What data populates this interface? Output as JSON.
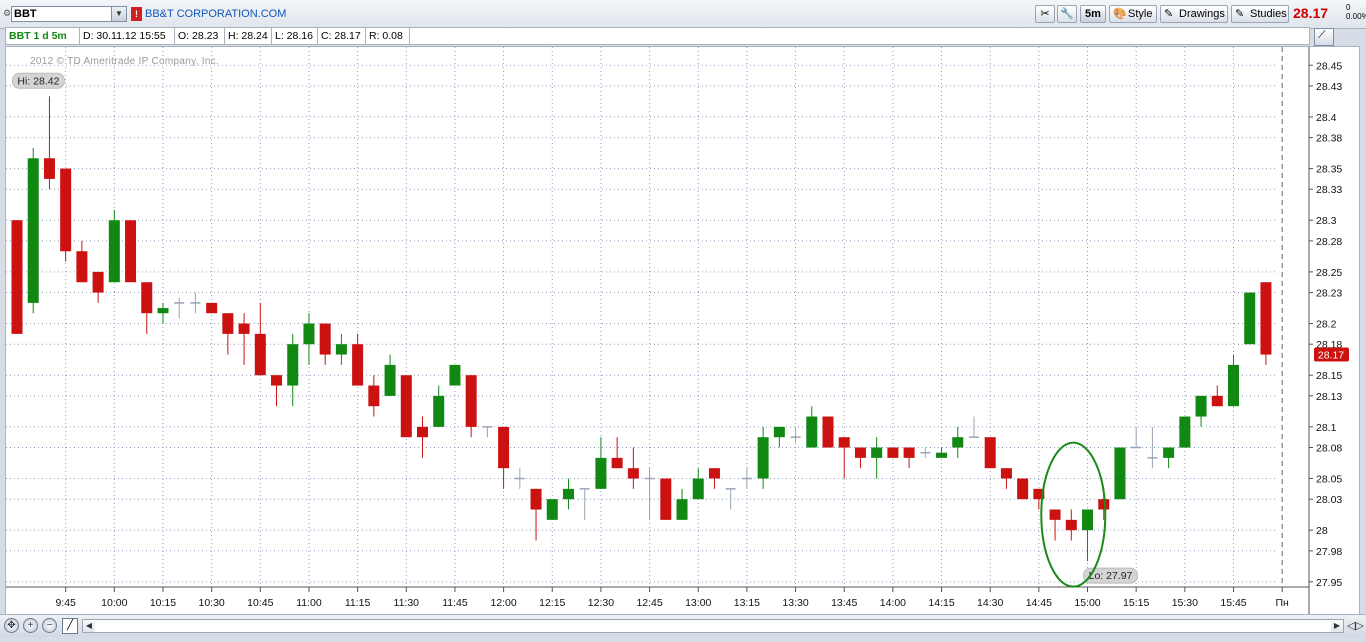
{
  "header": {
    "symbol": "BBT",
    "company_link": "BB&T CORPORATION.COM",
    "toolbar": {
      "interval_label": "5m",
      "style_label": "Style",
      "drawings_label": "Drawings",
      "studies_label": "Studies"
    },
    "last_price": "28.17",
    "change": "0",
    "change_pct": "0.00%"
  },
  "infobar": {
    "symbol_period": "BBT 1 d 5m",
    "date": "D: 30.11.12 15:55",
    "open": "O: 28.23",
    "high": "H: 28.24",
    "low": "L: 28.16",
    "close": "C: 28.17",
    "range": "R: 0.08"
  },
  "copyright": "2012 © TD Ameritrade IP Company, Inc.",
  "hi_label": "Hi: 28.42",
  "lo_label": "Lo: 27.97",
  "price_tag": "28.17",
  "colors": {
    "up": "#118811",
    "down": "#cc1111",
    "doji": "#9aa4b4",
    "ellipse": "#1a8a1a",
    "grid": "#8f9fb8"
  },
  "chart_data": {
    "type": "candlestick",
    "interval": "5m",
    "y_ticks": [
      "28.45",
      "28.43",
      "28.4",
      "28.38",
      "28.35",
      "28.33",
      "28.3",
      "28.28",
      "28.25",
      "28.23",
      "28.2",
      "28.18",
      "28.15",
      "28.13",
      "28.1",
      "28.08",
      "28.05",
      "28.03",
      "28",
      "27.98",
      "27.95"
    ],
    "ylim": [
      27.945,
      28.458
    ],
    "x_ticks": [
      {
        "label": "9:45",
        "i": 3
      },
      {
        "label": "10:00",
        "i": 6
      },
      {
        "label": "10:15",
        "i": 9
      },
      {
        "label": "10:30",
        "i": 12
      },
      {
        "label": "10:45",
        "i": 15
      },
      {
        "label": "11:00",
        "i": 18
      },
      {
        "label": "11:15",
        "i": 21
      },
      {
        "label": "11:30",
        "i": 24
      },
      {
        "label": "11:45",
        "i": 27
      },
      {
        "label": "12:00",
        "i": 30
      },
      {
        "label": "12:15",
        "i": 33
      },
      {
        "label": "12:30",
        "i": 36
      },
      {
        "label": "12:45",
        "i": 39
      },
      {
        "label": "13:00",
        "i": 42
      },
      {
        "label": "13:15",
        "i": 45
      },
      {
        "label": "13:30",
        "i": 48
      },
      {
        "label": "13:45",
        "i": 51
      },
      {
        "label": "14:00",
        "i": 54
      },
      {
        "label": "14:15",
        "i": 57
      },
      {
        "label": "14:30",
        "i": 60
      },
      {
        "label": "14:45",
        "i": 63
      },
      {
        "label": "15:00",
        "i": 66
      },
      {
        "label": "15:15",
        "i": 69
      },
      {
        "label": "15:30",
        "i": 72
      },
      {
        "label": "15:45",
        "i": 75
      },
      {
        "label": "Пн",
        "i": 78
      }
    ],
    "candles": [
      {
        "o": 28.3,
        "h": 28.3,
        "l": 28.19,
        "c": 28.19
      },
      {
        "o": 28.22,
        "h": 28.37,
        "l": 28.21,
        "c": 28.36
      },
      {
        "o": 28.36,
        "h": 28.42,
        "l": 28.33,
        "c": 28.34
      },
      {
        "o": 28.35,
        "h": 28.35,
        "l": 28.26,
        "c": 28.27
      },
      {
        "o": 28.27,
        "h": 28.28,
        "l": 28.24,
        "c": 28.24
      },
      {
        "o": 28.25,
        "h": 28.25,
        "l": 28.22,
        "c": 28.23
      },
      {
        "o": 28.24,
        "h": 28.31,
        "l": 28.24,
        "c": 28.3
      },
      {
        "o": 28.3,
        "h": 28.3,
        "l": 28.24,
        "c": 28.24
      },
      {
        "o": 28.24,
        "h": 28.24,
        "l": 28.19,
        "c": 28.21
      },
      {
        "o": 28.21,
        "h": 28.22,
        "l": 28.2,
        "c": 28.215
      },
      {
        "o": 28.22,
        "h": 28.225,
        "l": 28.205,
        "c": 28.22
      },
      {
        "o": 28.22,
        "h": 28.23,
        "l": 28.21,
        "c": 28.22
      },
      {
        "o": 28.22,
        "h": 28.22,
        "l": 28.21,
        "c": 28.21
      },
      {
        "o": 28.21,
        "h": 28.21,
        "l": 28.17,
        "c": 28.19
      },
      {
        "o": 28.2,
        "h": 28.21,
        "l": 28.16,
        "c": 28.19
      },
      {
        "o": 28.19,
        "h": 28.22,
        "l": 28.15,
        "c": 28.15
      },
      {
        "o": 28.15,
        "h": 28.15,
        "l": 28.12,
        "c": 28.14
      },
      {
        "o": 28.14,
        "h": 28.19,
        "l": 28.12,
        "c": 28.18
      },
      {
        "o": 28.18,
        "h": 28.21,
        "l": 28.16,
        "c": 28.2
      },
      {
        "o": 28.2,
        "h": 28.2,
        "l": 28.16,
        "c": 28.17
      },
      {
        "o": 28.17,
        "h": 28.19,
        "l": 28.16,
        "c": 28.18
      },
      {
        "o": 28.18,
        "h": 28.19,
        "l": 28.14,
        "c": 28.14
      },
      {
        "o": 28.14,
        "h": 28.15,
        "l": 28.11,
        "c": 28.12
      },
      {
        "o": 28.13,
        "h": 28.17,
        "l": 28.13,
        "c": 28.16
      },
      {
        "o": 28.15,
        "h": 28.15,
        "l": 28.09,
        "c": 28.09
      },
      {
        "o": 28.1,
        "h": 28.11,
        "l": 28.07,
        "c": 28.09
      },
      {
        "o": 28.1,
        "h": 28.14,
        "l": 28.1,
        "c": 28.13
      },
      {
        "o": 28.14,
        "h": 28.16,
        "l": 28.14,
        "c": 28.16
      },
      {
        "o": 28.15,
        "h": 28.15,
        "l": 28.09,
        "c": 28.1
      },
      {
        "o": 28.1,
        "h": 28.1,
        "l": 28.09,
        "c": 28.1
      },
      {
        "o": 28.1,
        "h": 28.1,
        "l": 28.04,
        "c": 28.06
      },
      {
        "o": 28.05,
        "h": 28.06,
        "l": 28.04,
        "c": 28.05
      },
      {
        "o": 28.04,
        "h": 28.04,
        "l": 27.99,
        "c": 28.02
      },
      {
        "o": 28.01,
        "h": 28.03,
        "l": 28.01,
        "c": 28.03
      },
      {
        "o": 28.03,
        "h": 28.05,
        "l": 28.02,
        "c": 28.04
      },
      {
        "o": 28.04,
        "h": 28.04,
        "l": 28.01,
        "c": 28.04
      },
      {
        "o": 28.04,
        "h": 28.09,
        "l": 28.04,
        "c": 28.07
      },
      {
        "o": 28.07,
        "h": 28.09,
        "l": 28.06,
        "c": 28.06
      },
      {
        "o": 28.06,
        "h": 28.08,
        "l": 28.04,
        "c": 28.05
      },
      {
        "o": 28.05,
        "h": 28.06,
        "l": 28.01,
        "c": 28.05
      },
      {
        "o": 28.05,
        "h": 28.05,
        "l": 28.01,
        "c": 28.01
      },
      {
        "o": 28.01,
        "h": 28.04,
        "l": 28.01,
        "c": 28.03
      },
      {
        "o": 28.03,
        "h": 28.06,
        "l": 28.03,
        "c": 28.05
      },
      {
        "o": 28.06,
        "h": 28.06,
        "l": 28.04,
        "c": 28.05
      },
      {
        "o": 28.04,
        "h": 28.04,
        "l": 28.02,
        "c": 28.04
      },
      {
        "o": 28.05,
        "h": 28.06,
        "l": 28.04,
        "c": 28.05
      },
      {
        "o": 28.05,
        "h": 28.1,
        "l": 28.04,
        "c": 28.09
      },
      {
        "o": 28.09,
        "h": 28.1,
        "l": 28.08,
        "c": 28.1
      },
      {
        "o": 28.09,
        "h": 28.1,
        "l": 28.085,
        "c": 28.09
      },
      {
        "o": 28.08,
        "h": 28.12,
        "l": 28.08,
        "c": 28.11
      },
      {
        "o": 28.11,
        "h": 28.11,
        "l": 28.08,
        "c": 28.08
      },
      {
        "o": 28.09,
        "h": 28.09,
        "l": 28.05,
        "c": 28.08
      },
      {
        "o": 28.08,
        "h": 28.08,
        "l": 28.06,
        "c": 28.07
      },
      {
        "o": 28.07,
        "h": 28.09,
        "l": 28.05,
        "c": 28.08
      },
      {
        "o": 28.08,
        "h": 28.08,
        "l": 28.07,
        "c": 28.07
      },
      {
        "o": 28.08,
        "h": 28.08,
        "l": 28.06,
        "c": 28.07
      },
      {
        "o": 28.075,
        "h": 28.08,
        "l": 28.07,
        "c": 28.075
      },
      {
        "o": 28.07,
        "h": 28.08,
        "l": 28.07,
        "c": 28.075
      },
      {
        "o": 28.08,
        "h": 28.1,
        "l": 28.07,
        "c": 28.09
      },
      {
        "o": 28.09,
        "h": 28.11,
        "l": 28.09,
        "c": 28.09
      },
      {
        "o": 28.09,
        "h": 28.09,
        "l": 28.06,
        "c": 28.06
      },
      {
        "o": 28.06,
        "h": 28.06,
        "l": 28.04,
        "c": 28.05
      },
      {
        "o": 28.05,
        "h": 28.05,
        "l": 28.03,
        "c": 28.03
      },
      {
        "o": 28.04,
        "h": 28.04,
        "l": 28.02,
        "c": 28.03
      },
      {
        "o": 28.02,
        "h": 28.02,
        "l": 27.99,
        "c": 28.01
      },
      {
        "o": 28.01,
        "h": 28.02,
        "l": 27.99,
        "c": 28.0
      },
      {
        "o": 28.0,
        "h": 28.02,
        "l": 27.97,
        "c": 28.02
      },
      {
        "o": 28.03,
        "h": 28.04,
        "l": 28.01,
        "c": 28.02
      },
      {
        "o": 28.03,
        "h": 28.08,
        "l": 28.03,
        "c": 28.08
      },
      {
        "o": 28.08,
        "h": 28.1,
        "l": 28.08,
        "c": 28.08
      },
      {
        "o": 28.07,
        "h": 28.1,
        "l": 28.06,
        "c": 28.07
      },
      {
        "o": 28.07,
        "h": 28.08,
        "l": 28.06,
        "c": 28.08
      },
      {
        "o": 28.08,
        "h": 28.11,
        "l": 28.08,
        "c": 28.11
      },
      {
        "o": 28.11,
        "h": 28.13,
        "l": 28.1,
        "c": 28.13
      },
      {
        "o": 28.13,
        "h": 28.14,
        "l": 28.12,
        "c": 28.12
      },
      {
        "o": 28.12,
        "h": 28.17,
        "l": 28.12,
        "c": 28.16
      },
      {
        "o": 28.18,
        "h": 28.23,
        "l": 28.18,
        "c": 28.23
      },
      {
        "o": 28.24,
        "h": 28.24,
        "l": 28.16,
        "c": 28.17
      }
    ]
  }
}
